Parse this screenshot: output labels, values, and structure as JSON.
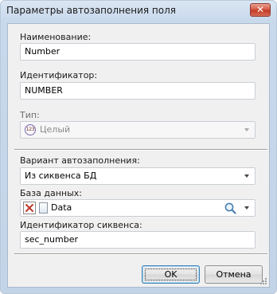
{
  "window": {
    "title": "Параметры автозаполнения поля",
    "close_label": "✕"
  },
  "form": {
    "name_label": "Наименование:",
    "name_value": "Number",
    "id_label": "Идентификатор:",
    "id_value": "NUMBER",
    "type_label": "Тип:",
    "type_icon_text": "123",
    "type_value": "Целый",
    "autofill_label": "Вариант автозаполнения:",
    "autofill_value": "Из сиквенса БД",
    "db_label": "База данных:",
    "db_value": "Data",
    "seq_label": "Идентификатор сиквенса:",
    "seq_value": "sec_number"
  },
  "buttons": {
    "ok": "OK",
    "cancel": "Отмена"
  },
  "icons": {
    "type": "integer-type-icon",
    "clear": "clear-x-icon",
    "database": "database-icon",
    "search": "search-icon",
    "dropdown": "chevron-down-icon"
  }
}
